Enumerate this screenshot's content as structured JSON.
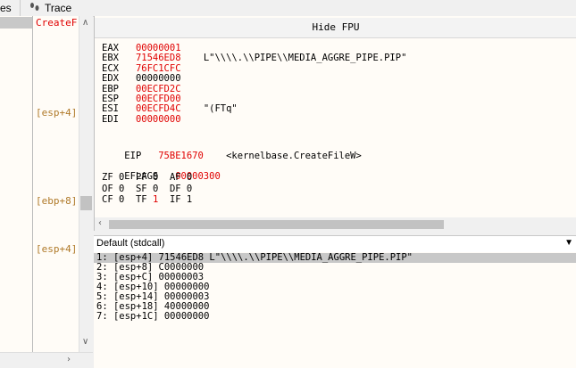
{
  "tabs": [
    {
      "label": "es"
    },
    {
      "label": "Trace",
      "icon": "footprints-icon"
    }
  ],
  "left_panel": {
    "top_label": "CreateF",
    "labels": [
      "[esp+4]",
      "[ebp+8]",
      "[esp+4]"
    ]
  },
  "registers": {
    "hide_fpu_label": "Hide FPU",
    "general": [
      {
        "name": "EAX",
        "value": "00000001",
        "comment": ""
      },
      {
        "name": "EBX",
        "value": "71546ED8",
        "comment": "L\"\\\\\\\\.\\\\PIPE\\\\MEDIA_AGGRE_PIPE.PIP\""
      },
      {
        "name": "ECX",
        "value": "76FC1CFC",
        "comment": ""
      },
      {
        "name": "EDX",
        "value": "00000000",
        "comment": ""
      },
      {
        "name": "EBP",
        "value": "00ECFD2C",
        "comment": ""
      },
      {
        "name": "ESP",
        "value": "00ECFD00",
        "comment": ""
      },
      {
        "name": "ESI",
        "value": "00ECFD4C",
        "comment": "\"(FTq\""
      },
      {
        "name": "EDI",
        "value": "00000000",
        "comment": ""
      }
    ],
    "eip": {
      "name": "EIP",
      "value": "75BE1670",
      "comment": "<kernelbase.CreateFileW>"
    },
    "eflags": {
      "name": "EFLAGS",
      "value": "00000300"
    },
    "flags": [
      [
        {
          "n": "ZF",
          "v": "0"
        },
        {
          "n": "PF",
          "v": "0"
        },
        {
          "n": "AF",
          "v": "0"
        }
      ],
      [
        {
          "n": "OF",
          "v": "0"
        },
        {
          "n": "SF",
          "v": "0"
        },
        {
          "n": "DF",
          "v": "0"
        }
      ],
      [
        {
          "n": "CF",
          "v": "0"
        },
        {
          "n": "TF",
          "v": "1",
          "changed": true
        },
        {
          "n": "IF",
          "v": "1"
        }
      ]
    ]
  },
  "call_stack": {
    "convention": "Default (stdcall)",
    "rows": [
      {
        "text": "1: [esp+4] 71546ED8 L\"\\\\\\\\.\\\\PIPE\\\\MEDIA_AGGRE_PIPE.PIP\"",
        "selected": true
      },
      {
        "text": "2: [esp+8] C0000000"
      },
      {
        "text": "3: [esp+C] 00000003"
      },
      {
        "text": "4: [esp+10] 00000000"
      },
      {
        "text": "5: [esp+14] 00000003"
      },
      {
        "text": "6: [esp+18] 40000000"
      },
      {
        "text": "7: [esp+1C] 00000000"
      }
    ]
  },
  "colors": {
    "value_changed": "#e00000",
    "label": "#b07a2a",
    "selection": "#c8c8c8"
  }
}
